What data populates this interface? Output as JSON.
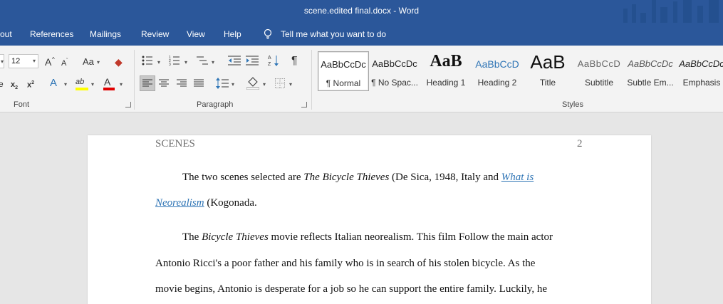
{
  "window": {
    "title": "scene.edited final.docx  -  Word"
  },
  "menu": {
    "items": [
      "out",
      "References",
      "Mailings",
      "Review",
      "View",
      "Help"
    ],
    "tell_me": "Tell me what you want to do"
  },
  "ribbon": {
    "font_group": {
      "label": "Font",
      "font_size": "12",
      "change_case": "Aa",
      "grow": "A",
      "shrink": "A",
      "subscript": "x",
      "superscript": "x",
      "text_effects": "A",
      "highlight": "ab",
      "font_color": "A"
    },
    "paragraph_group": {
      "label": "Paragraph",
      "pilcrow": "¶"
    },
    "styles_group": {
      "label": "Styles",
      "items": [
        {
          "preview": "AaBbCcDc",
          "label": "¶ Normal"
        },
        {
          "preview": "AaBbCcDc",
          "label": "¶ No Spac..."
        },
        {
          "preview": "AaB",
          "label": "Heading 1"
        },
        {
          "preview": "AaBbCcD",
          "label": "Heading 2"
        },
        {
          "preview": "AaB",
          "label": "Title"
        },
        {
          "preview": "AaBbCcD",
          "label": "Subtitle"
        },
        {
          "preview": "AaBbCcDc",
          "label": "Subtle Em..."
        },
        {
          "preview": "AaBbCcDc",
          "label": "Emphasis"
        }
      ]
    }
  },
  "document": {
    "header_title": "SCENES",
    "page_number": "2",
    "para1_line1": {
      "t1": "The two scenes selected are ",
      "t2": "The Bicycle Thieves",
      "t3": " (De Sica, 1948, Italy and  ",
      "link": "What is"
    },
    "para1_line2": {
      "link": "Neorealism",
      "t2": " (Kogonada."
    },
    "para2_line1": {
      "t1": "The ",
      "t2": "Bicycle Thieves",
      "t3": " movie reflects Italian neorealism. This film Follow the main actor"
    },
    "para2_line2": "Antonio Ricci's a poor father and his family who is in search of his stolen bicycle. As the",
    "para2_line3": "movie begins, Antonio is desperate for a job so he can support the entire family. Luckily, he"
  }
}
